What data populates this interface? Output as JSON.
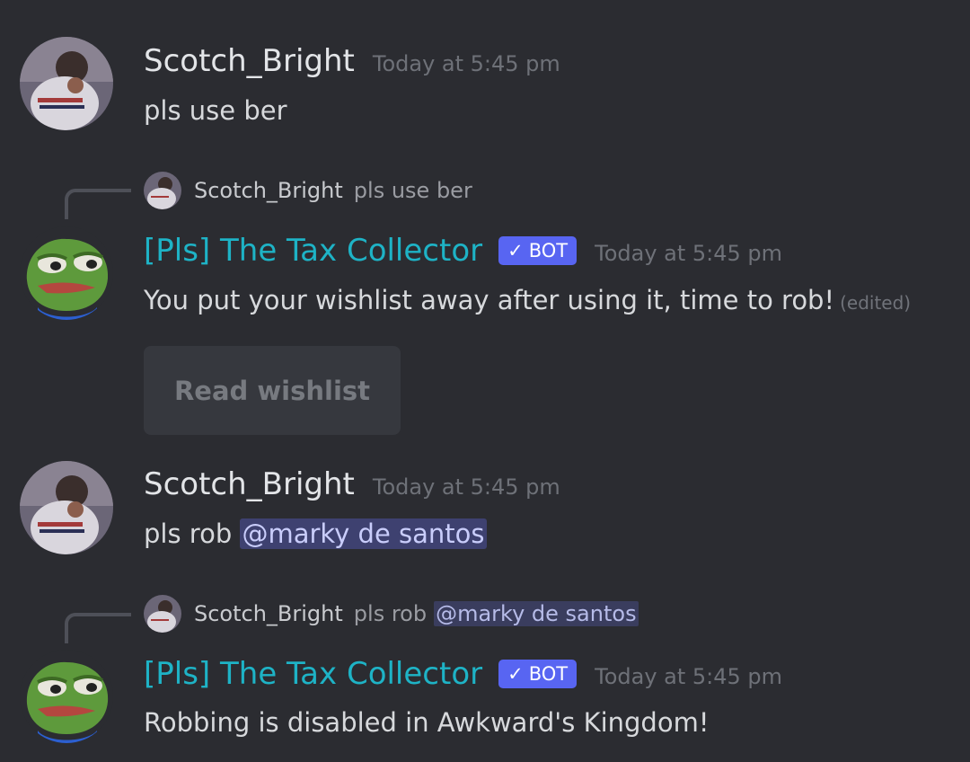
{
  "messages": [
    {
      "author": "Scotch_Bright",
      "timestamp": "Today at 5:45 pm",
      "text": "pls use ber"
    },
    {
      "reply": {
        "author": "Scotch_Bright",
        "text": "pls use ber"
      },
      "author": "[Pls] The Tax Collector",
      "bot_tag": "BOT",
      "timestamp": "Today at 5:45 pm",
      "text": "You put your wishlist away after using it, time to rob!",
      "edited": "(edited)",
      "button_label": "Read wishlist"
    },
    {
      "author": "Scotch_Bright",
      "timestamp": "Today at 5:45 pm",
      "text": "pls rob",
      "mention": "@marky de santos"
    },
    {
      "reply": {
        "author": "Scotch_Bright",
        "text": "pls rob",
        "mention": "@marky de santos"
      },
      "author": "[Pls] The Tax Collector",
      "bot_tag": "BOT",
      "timestamp": "Today at 5:45 pm",
      "text": "Robbing is disabled in Awkward's Kingdom!"
    }
  ],
  "colors": {
    "background": "#2b2c31",
    "bot_name": "#1eb3c6",
    "bot_tag": "#5865f2",
    "mention_bg": "#3e4170"
  },
  "icons": {
    "user_avatar": "user-avatar-photo",
    "bot_avatar": "pepe-frog-avatar",
    "bot_verified": "checkmark-icon"
  }
}
